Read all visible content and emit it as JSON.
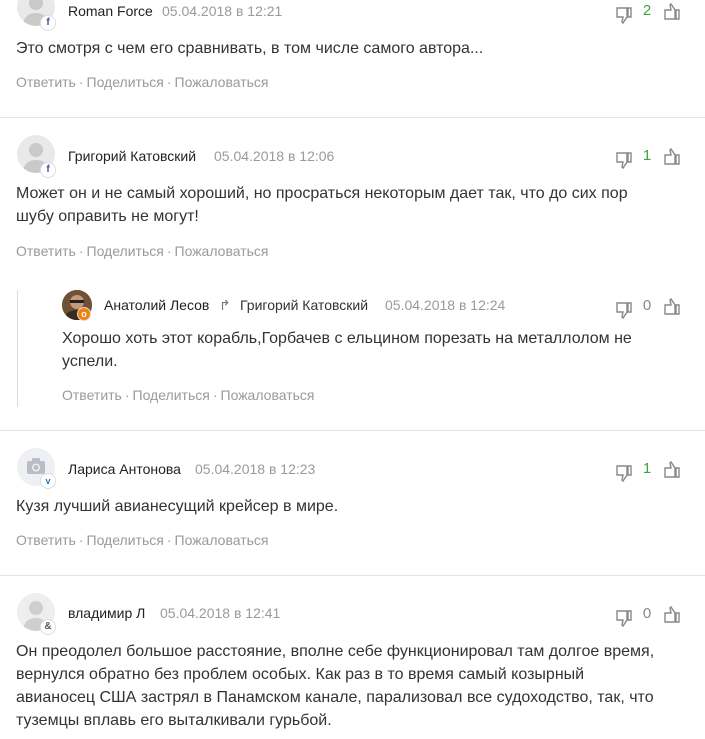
{
  "actions": {
    "reply": "Ответить",
    "share": "Поделиться",
    "report": "Пожаловаться",
    "sep": "·"
  },
  "colors": {
    "positive_score": "#3aa63a",
    "zero_score": "#888888",
    "date": "#9a9a9a"
  },
  "comments": [
    {
      "author": "Roman Force",
      "date": "05.04.2018 в 12:21",
      "badge_icon": "facebook-icon",
      "score": "2",
      "lines": [
        "Это смотря с чем его сравнивать, в том числе самого автора..."
      ]
    },
    {
      "author": "Григорий Катовский",
      "date": "05.04.2018 в 12:06",
      "badge_icon": "facebook-icon",
      "score": "1",
      "lines": [
        "Может он и не самый хороший, но просраться некоторым дает так, что до сих пор",
        "шубу оправить не могут!"
      ]
    },
    {
      "author": "Анатолий Лесов",
      "reply_to": "Григорий Катовский",
      "date": "05.04.2018 в 12:24",
      "badge_icon": "odnoklassniki-icon",
      "score": "0",
      "lines": [
        "Хорошо хоть этот корабль,Горбачев с ельцином порезать на металлолом не",
        "успели."
      ]
    },
    {
      "author": "Лариса Антонова",
      "date": "05.04.2018 в 12:23",
      "badge_icon": "vk-icon",
      "score": "1",
      "lines": [
        "Кузя лучший авианесущий крейсер в мире."
      ]
    },
    {
      "author": "владимир Л",
      "date": "05.04.2018 в 12:41",
      "badge_icon": "ampersand-icon",
      "score": "0",
      "lines": [
        "Он преодолел большое расстояние, вполне себе функционировал там долгое время,",
        "вернулся обратно без проблем особых. Как раз в то время самый козырный",
        "авианосец США застрял в Панамском канале, парализовал все судоходство, так, что",
        "туземцы вплавь его выталкивали гурьбой."
      ]
    }
  ]
}
